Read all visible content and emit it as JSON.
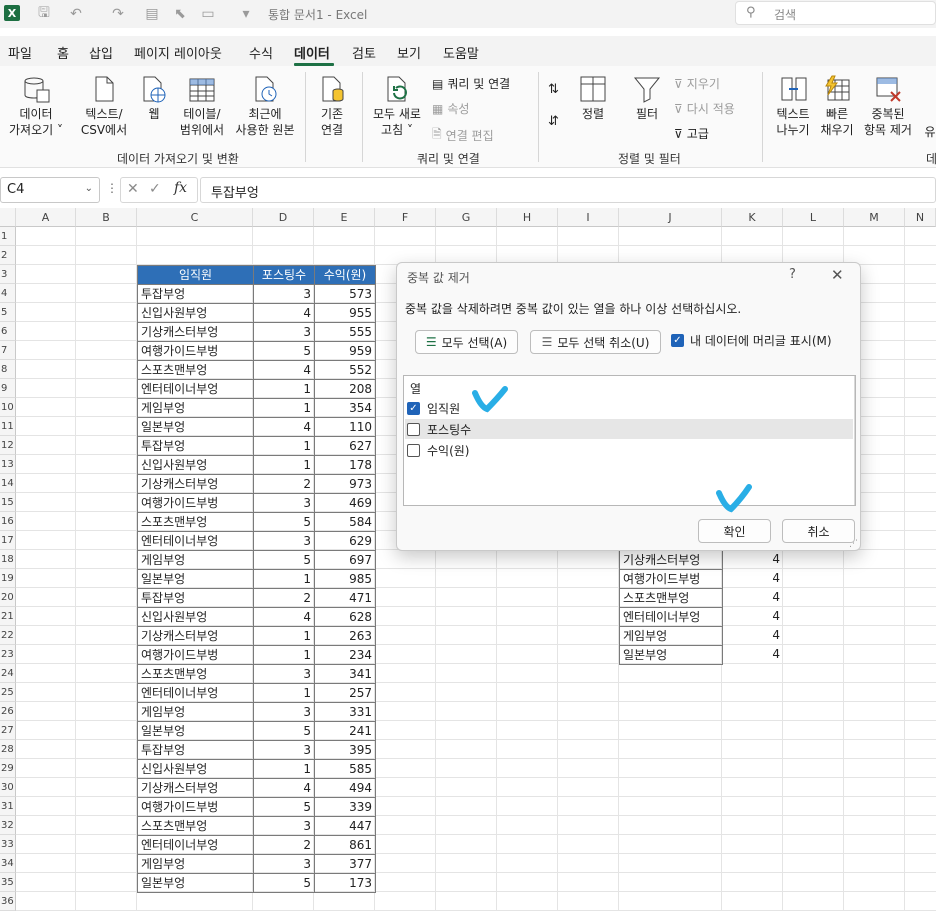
{
  "titlebar": {
    "logo": "X",
    "title": "통합 문서1  -  Excel",
    "search_placeholder": "검색"
  },
  "menu": {
    "tabs": [
      "파일",
      "홈",
      "삽입",
      "페이지 레이아웃",
      "수식",
      "데이터",
      "검토",
      "보기",
      "도움말"
    ],
    "active": "데이터"
  },
  "ribbon": {
    "get_data": {
      "line1": "데이터",
      "line2": "가져오기 ˅"
    },
    "text_csv": {
      "line1": "텍스트/",
      "line2": "CSV에서"
    },
    "web": {
      "line1": "웹"
    },
    "table_range": {
      "line1": "테이블/",
      "line2": "범위에서"
    },
    "recent": {
      "line1": "최근에",
      "line2": "사용한 원본"
    },
    "existing": {
      "line1": "기존",
      "line2": "연결"
    },
    "refresh_all": {
      "line1": "모두 새로",
      "line2": "고침 ˅"
    },
    "queries": "쿼리 및 연결",
    "properties": "속성",
    "edit_links": "연결 편집",
    "sort": "정렬",
    "filter": "필터",
    "clear": "지우기",
    "reapply": "다시 적용",
    "advanced": "고급",
    "text_to_col": {
      "line1": "텍스트",
      "line2": "나누기"
    },
    "flash_fill": {
      "line1": "빠른",
      "line2": "채우기"
    },
    "remove_dup": {
      "line1": "중복된",
      "line2": "항목 제거"
    },
    "cut_right": "유",
    "group_get": "데이터 가져오기 및 변환",
    "group_query": "쿼리 및 연결",
    "group_sort": "정렬 및 필터",
    "group_cut": "데"
  },
  "formula": {
    "namebox": "C4",
    "fx": "fx",
    "value": "투잡부엉"
  },
  "grid": {
    "columns": [
      "A",
      "B",
      "C",
      "D",
      "E",
      "F",
      "G",
      "H",
      "I",
      "J",
      "K",
      "L",
      "M",
      "N"
    ],
    "rows": [
      "1",
      "2",
      "3",
      "4",
      "5",
      "6",
      "7",
      "8",
      "9",
      "10",
      "11",
      "12",
      "13",
      "14",
      "15",
      "16",
      "17",
      "18",
      "19",
      "20",
      "21",
      "22",
      "23",
      "24",
      "25",
      "26",
      "27",
      "28",
      "29",
      "30",
      "31",
      "32",
      "33",
      "34",
      "35",
      "36"
    ],
    "headers": [
      "임직원",
      "포스팅수",
      "수익(원)"
    ],
    "data": [
      [
        "투잡부엉",
        "3",
        "573"
      ],
      [
        "신입사원부엉",
        "4",
        "955"
      ],
      [
        "기상캐스터부엉",
        "3",
        "555"
      ],
      [
        "여행가이드부벙",
        "5",
        "959"
      ],
      [
        "스포츠맨부엉",
        "4",
        "552"
      ],
      [
        "엔터테이너부엉",
        "1",
        "208"
      ],
      [
        "게임부엉",
        "1",
        "354"
      ],
      [
        "일본부엉",
        "4",
        "110"
      ],
      [
        "투잡부엉",
        "1",
        "627"
      ],
      [
        "신입사원부엉",
        "1",
        "178"
      ],
      [
        "기상캐스터부엉",
        "2",
        "973"
      ],
      [
        "여행가이드부벙",
        "3",
        "469"
      ],
      [
        "스포츠맨부엉",
        "5",
        "584"
      ],
      [
        "엔터테이너부엉",
        "3",
        "629"
      ],
      [
        "게임부엉",
        "5",
        "697"
      ],
      [
        "일본부엉",
        "1",
        "985"
      ],
      [
        "투잡부엉",
        "2",
        "471"
      ],
      [
        "신입사원부엉",
        "4",
        "628"
      ],
      [
        "기상캐스터부엉",
        "1",
        "263"
      ],
      [
        "여행가이드부벙",
        "1",
        "234"
      ],
      [
        "스포츠맨부엉",
        "3",
        "341"
      ],
      [
        "엔터테이너부엉",
        "1",
        "257"
      ],
      [
        "게임부엉",
        "3",
        "331"
      ],
      [
        "일본부엉",
        "5",
        "241"
      ],
      [
        "투잡부엉",
        "3",
        "395"
      ],
      [
        "신입사원부엉",
        "1",
        "585"
      ],
      [
        "기상캐스터부엉",
        "4",
        "494"
      ],
      [
        "여행가이드부벙",
        "5",
        "339"
      ],
      [
        "스포츠맨부엉",
        "3",
        "447"
      ],
      [
        "엔터테이너부엉",
        "2",
        "861"
      ],
      [
        "게임부엉",
        "3",
        "377"
      ],
      [
        "일본부엉",
        "5",
        "173"
      ]
    ],
    "side_table": [
      [
        "기상캐스터부엉",
        "4"
      ],
      [
        "여행가이드부벙",
        "4"
      ],
      [
        "스포츠맨부엉",
        "4"
      ],
      [
        "엔터테이너부엉",
        "4"
      ],
      [
        "게임부엉",
        "4"
      ],
      [
        "일본부엉",
        "4"
      ]
    ]
  },
  "dialog": {
    "title": "중복 값 제거",
    "help": "?",
    "close": "✕",
    "message": "중복 값을 삭제하려면 중복 값이 있는 열을 하나 이상 선택하십시오.",
    "select_all": "모두 선택(A)",
    "unselect_all": "모두 선택 취소(U)",
    "has_headers": "내 데이터에 머리글 표시(M)",
    "list_header": "열",
    "columns": [
      {
        "label": "임직원",
        "checked": true
      },
      {
        "label": "포스팅수",
        "checked": false
      },
      {
        "label": "수익(원)",
        "checked": false
      }
    ],
    "ok": "확인",
    "cancel": "취소"
  },
  "colors": {
    "accent_green": "#1e7145",
    "table_header_blue": "#2e6fb7",
    "checkbox_blue": "#1f63b8",
    "annotation_cyan": "#29aee6"
  }
}
